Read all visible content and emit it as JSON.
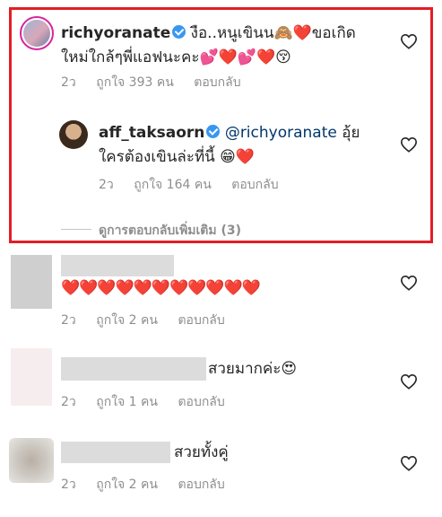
{
  "comments": [
    {
      "username": "richyoranate",
      "text_line1": "งือ..หนูเขินน🙈❤️ขอเกิด",
      "text_line2": "ใหม่ใกล้ๆพี่แอฟนะคะ💕❤️💕❤️😚",
      "time": "2ว",
      "likes": "ถูกใจ 393 คน",
      "reply_label": "ตอบกลับ"
    },
    {
      "username": "aff_taksaorn",
      "mention": "@richyoranate",
      "text_line1_rest": " อุ้ย",
      "text_line2": "ใครต้องเขินล่ะที่นี้ 😁❤️",
      "time": "2ว",
      "likes": "ถูกใจ 164 คน",
      "reply_label": "ตอบกลับ"
    },
    {
      "text": "❤️❤️❤️❤️❤️❤️❤️❤️❤️❤️❤️",
      "time": "2ว",
      "likes": "ถูกใจ 2 คน",
      "reply_label": "ตอบกลับ"
    },
    {
      "text": "สวยมากค่ะ😍",
      "time": "2ว",
      "likes": "ถูกใจ 1 คน",
      "reply_label": "ตอบกลับ"
    },
    {
      "text": "สวยทั้งคู่",
      "time": "2ว",
      "likes": "ถูกใจ 2 คน",
      "reply_label": "ตอบกลับ"
    }
  ],
  "view_more_replies": "ดูการตอบกลับเพิ่มเติม (3)",
  "colors": {
    "highlight": "#e31e24",
    "verified": "#3897f0",
    "meta_text": "#8e8e8e",
    "mention": "#00376b"
  },
  "icons": {
    "like": "heart-outline-icon",
    "verified": "verified-badge-icon"
  }
}
